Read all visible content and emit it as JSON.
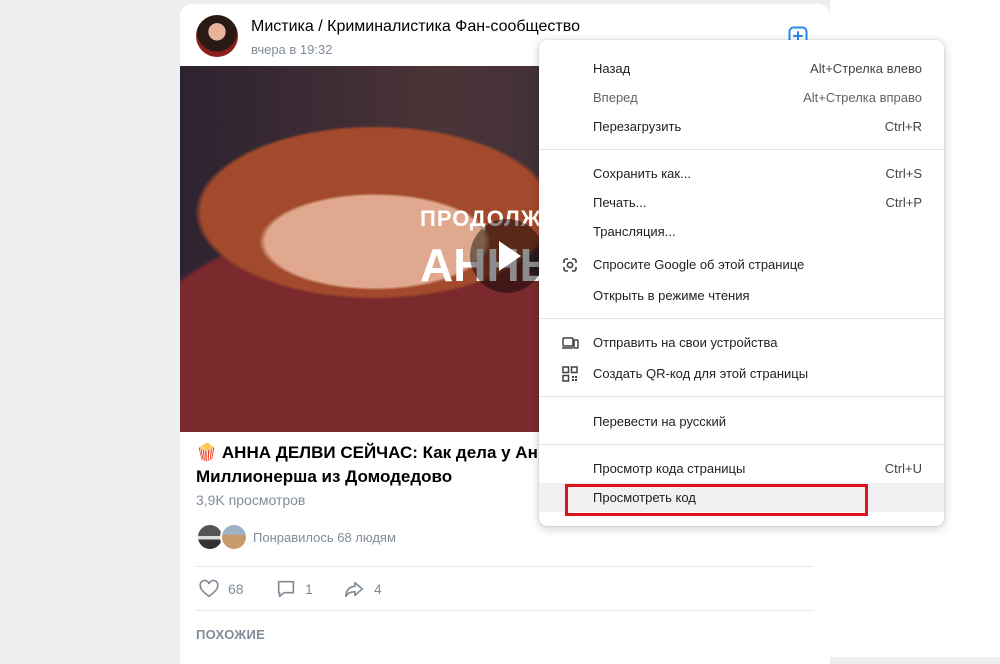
{
  "post": {
    "group_name": "Мистика / Криминалистика Фан-сообщество",
    "time": "вчера в 19:32",
    "video_text_line1": "ПРОДОЛЖ",
    "video_text_line2": "АННЫ",
    "emoji": "🍿",
    "title": "АННА ДЕЛВИ СЕЙЧАС: Как дела у Ан",
    "title_line2": "Миллионерша из Домодедово",
    "views": "3,9K просмотров",
    "likes_text": "Понравилось 68 людям",
    "actions": {
      "likes": "68",
      "comments": "1",
      "shares": "4"
    },
    "similar_label": "ПОХОЖИЕ"
  },
  "context_menu": {
    "items": [
      {
        "label": "Назад",
        "shortcut": "Alt+Стрелка влево"
      },
      {
        "label": "Вперед",
        "shortcut": "Alt+Стрелка вправо",
        "disabled": true
      },
      {
        "label": "Перезагрузить",
        "shortcut": "Ctrl+R"
      },
      {
        "label": "Сохранить как...",
        "shortcut": "Ctrl+S"
      },
      {
        "label": "Печать...",
        "shortcut": "Ctrl+P"
      },
      {
        "label": "Трансляция...",
        "shortcut": ""
      },
      {
        "label": "Спросите Google об этой странице",
        "shortcut": "",
        "icon": "google-lens-icon"
      },
      {
        "label": "Открыть в режиме чтения",
        "shortcut": ""
      },
      {
        "label": "Отправить на свои устройства",
        "shortcut": "",
        "icon": "devices-icon"
      },
      {
        "label": "Создать QR-код для этой страницы",
        "shortcut": "",
        "icon": "qr-code-icon"
      },
      {
        "label": "Перевести на русский",
        "shortcut": ""
      },
      {
        "label": "Просмотр кода страницы",
        "shortcut": "Ctrl+U"
      },
      {
        "label": "Просмотреть код",
        "shortcut": "",
        "hovered": true
      }
    ]
  },
  "colors": {
    "highlight_border": "#e2141b",
    "accent": "#2688eb",
    "muted_text": "#818c99"
  }
}
